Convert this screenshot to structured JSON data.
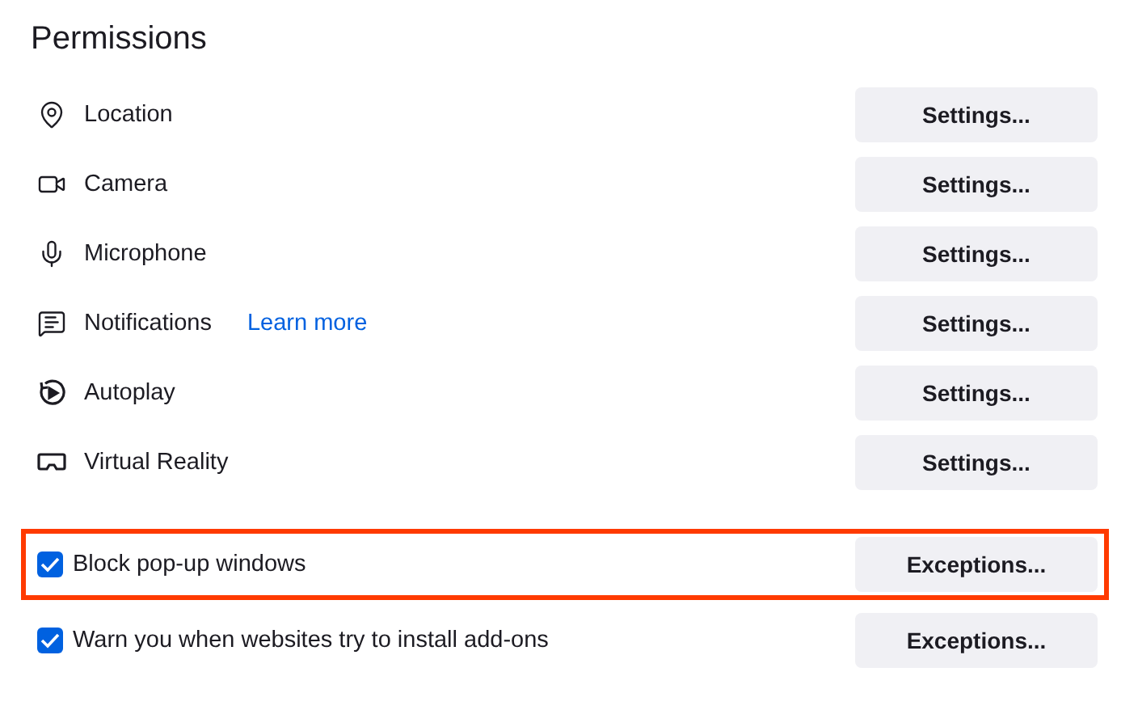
{
  "title": "Permissions",
  "permissions": [
    {
      "label": "Location",
      "button": "Settings..."
    },
    {
      "label": "Camera",
      "button": "Settings..."
    },
    {
      "label": "Microphone",
      "button": "Settings..."
    },
    {
      "label": "Notifications",
      "link": "Learn more",
      "button": "Settings..."
    },
    {
      "label": "Autoplay",
      "button": "Settings..."
    },
    {
      "label": "Virtual Reality",
      "button": "Settings..."
    }
  ],
  "options": [
    {
      "label": "Block pop-up windows",
      "checked": true,
      "highlighted": true,
      "button": "Exceptions..."
    },
    {
      "label": "Warn you when websites try to install add-ons",
      "checked": true,
      "highlighted": false,
      "button": "Exceptions..."
    }
  ]
}
